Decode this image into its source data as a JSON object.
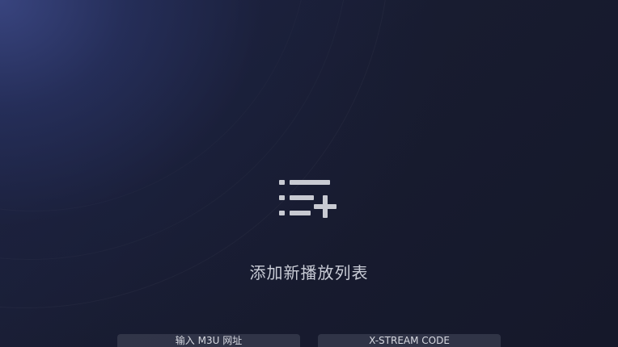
{
  "icons": {
    "playlist_add": "playlist-add-icon"
  },
  "main": {
    "title": "添加新播放列表"
  },
  "buttons": {
    "m3u_label": "输入 M3U 网址",
    "xtream_label": "X-STREAM CODE"
  },
  "colors": {
    "background": "#161a2b",
    "glow": "#3a4682",
    "text": "#c9ccd6",
    "button_bg": "#3a3e50",
    "icon": "#c8cad2"
  }
}
